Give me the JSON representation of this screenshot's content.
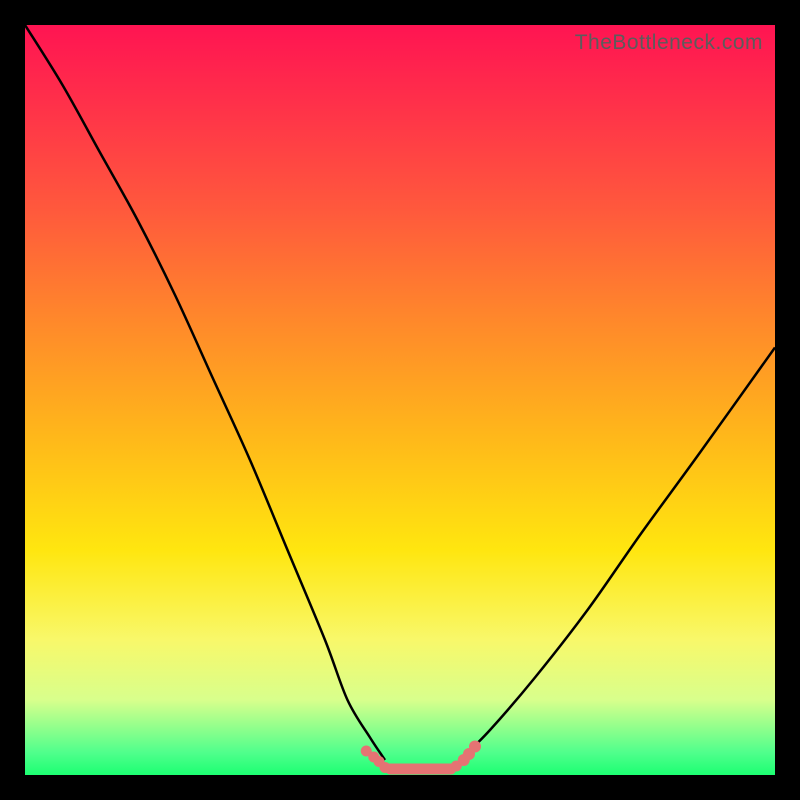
{
  "watermark": "TheBottleneck.com",
  "colors": {
    "dot": "#e57373",
    "curve": "#000000",
    "frame": "#000000"
  },
  "chart_data": {
    "type": "line",
    "title": "",
    "xlabel": "",
    "ylabel": "",
    "xlim": [
      0,
      100
    ],
    "ylim": [
      0,
      100
    ],
    "series": [
      {
        "name": "left-curve",
        "x": [
          0,
          5,
          10,
          15,
          20,
          25,
          30,
          35,
          40,
          43,
          46,
          48
        ],
        "y": [
          100,
          92,
          83,
          74,
          64,
          53,
          42,
          30,
          18,
          10,
          5,
          2
        ]
      },
      {
        "name": "right-curve",
        "x": [
          58,
          62,
          68,
          75,
          82,
          90,
          100
        ],
        "y": [
          2,
          6,
          13,
          22,
          32,
          43,
          57
        ]
      }
    ],
    "markers": {
      "left_cluster": [
        [
          45.5,
          3.2
        ],
        [
          46.5,
          2.4
        ],
        [
          47.2,
          1.8
        ]
      ],
      "bottom_run": [
        [
          48,
          1.0
        ],
        [
          50,
          0.8
        ],
        [
          52,
          0.8
        ],
        [
          54,
          0.8
        ],
        [
          56,
          0.9
        ],
        [
          57.5,
          1.2
        ]
      ],
      "right_cluster": [
        [
          58.5,
          2.0
        ],
        [
          59.2,
          2.8
        ],
        [
          60.0,
          3.8
        ]
      ]
    },
    "annotations": []
  }
}
